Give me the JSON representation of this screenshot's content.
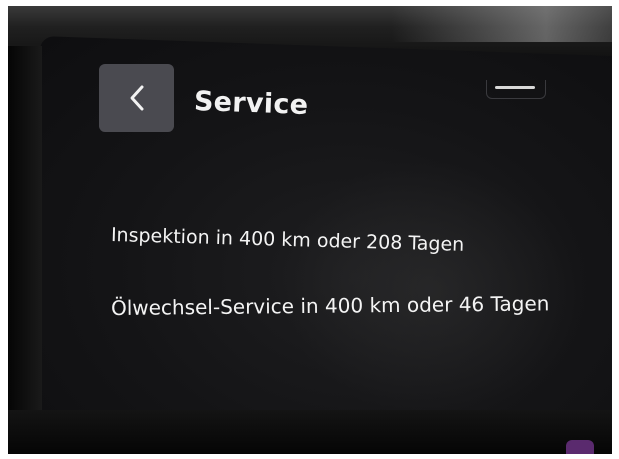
{
  "header": {
    "title": "Service",
    "back_icon": "chevron-left-icon",
    "menu_icon": "drag-handle-icon"
  },
  "service": {
    "items": [
      {
        "label": "Inspektion in 400 km oder 208 Tagen"
      },
      {
        "label": "Ölwechsel-Service in 400 km oder 46 Tagen"
      }
    ]
  },
  "colors": {
    "background": "#141416",
    "back_button": "#4a4a50",
    "text": "#f2f2f2",
    "accent": "#5a2a6e"
  }
}
